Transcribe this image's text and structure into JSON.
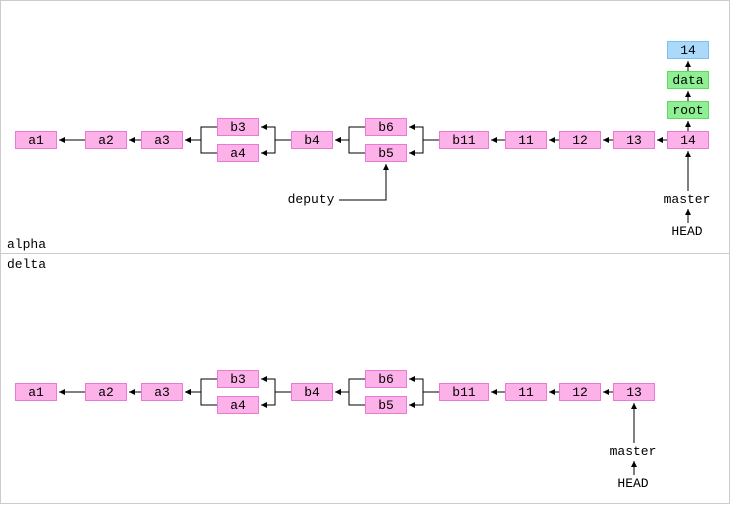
{
  "region_alpha": "alpha",
  "region_delta": "delta",
  "alpha": {
    "a1": "a1",
    "a2": "a2",
    "a3": "a3",
    "b3": "b3",
    "a4": "a4",
    "b4": "b4",
    "b6": "b6",
    "b5": "b5",
    "b11": "b11",
    "c11": "11",
    "c12": "12",
    "c13": "13",
    "c14": "14",
    "wd14": "14",
    "tree_data": "data",
    "tree_root": "root",
    "deputy": "deputy",
    "master": "master",
    "head": "HEAD"
  },
  "delta": {
    "a1": "a1",
    "a2": "a2",
    "a3": "a3",
    "b3": "b3",
    "a4": "a4",
    "b4": "b4",
    "b6": "b6",
    "b5": "b5",
    "b11": "b11",
    "c11": "11",
    "c12": "12",
    "c13": "13",
    "master": "master",
    "head": "HEAD"
  }
}
